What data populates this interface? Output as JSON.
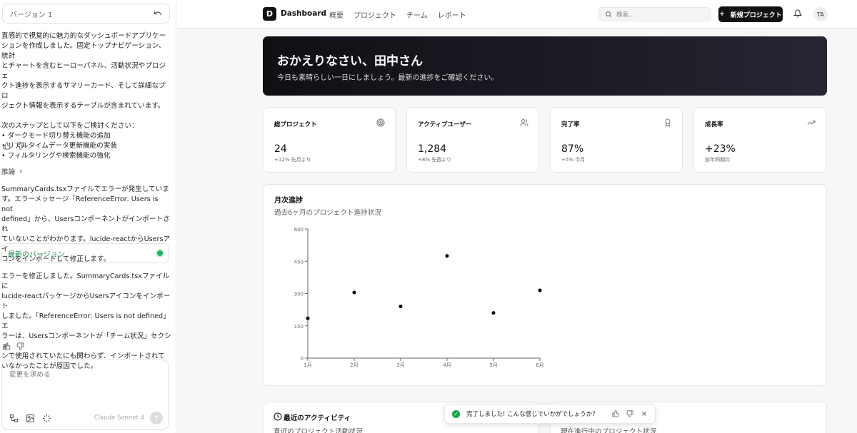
{
  "left_panel": {
    "version_label": "バージョン 1",
    "message1": "直感的で視覚的に魅力的なダッシュボードアプリケー\nションを作成しました。固定トップナビゲーション、統計\nとチャートを含むヒーローパネル、活動状況やプロジェ\nクト進捗を表示するサマリーカード、そして詳細なプロ\nジェクト情報を表示するテーブルが含まれています。\n\n次のステップとして以下をご検討ください：\n• ダークモード切り替え機能の追加\n• リアルタイムデータ更新機能の実装\n• フィルタリングや検索機能の強化",
    "reasoning_label": "推論",
    "message2": "SummaryCards.tsxファイルでエラーが発生していま\nす。エラーメッセージ「ReferenceError: Users is not\ndefined」から、Usersコンポーネントがインポートされ\nていないことがわかります。lucide-reactからUsersアイ\nコンをインポートして修正します。",
    "latest_version_label": "最新のバージョン",
    "message3": "エラーを修正しました。SummaryCards.tsxファイルに\nlucide-reactパッケージからUsersアイコンをインポート\nしました。「ReferenceError: Users is not defined」エ\nラーは、Usersコンポーネントが「チーム状況」セクショ\nンで使用されていたにも関わらず、インポートされて\nいなかったことが原因でした。",
    "input_placeholder": "変更を求める",
    "model_name": "Claude Sonnet 4"
  },
  "topbar": {
    "logo_letter": "D",
    "brand": "Dashboard",
    "nav": [
      "概要",
      "プロジェクト",
      "チーム",
      "レポート"
    ],
    "search_placeholder": "検索...",
    "new_project_label": "新規プロジェクト",
    "avatar_initials": "TA"
  },
  "hero": {
    "title": "おかえりなさい、田中さん",
    "subtitle": "今日も素晴らしい一日にしましょう。最新の進捗をご確認ください。"
  },
  "cards": [
    {
      "title": "総プロジェクト",
      "value": "24",
      "sub": "+12% 先月より",
      "icon": "target-icon"
    },
    {
      "title": "アクティブユーザー",
      "value": "1,284",
      "sub": "+8% 先週より",
      "icon": "users-icon"
    },
    {
      "title": "完了率",
      "value": "87%",
      "sub": "+5% 今月",
      "icon": "award-icon"
    },
    {
      "title": "成長率",
      "value": "+23%",
      "sub": "前年同期比",
      "icon": "trending-up-icon"
    }
  ],
  "chart_section": {
    "title": "月次進捗",
    "subtitle": "過去6ヶ月のプロジェクト進捗状況"
  },
  "chart_data": {
    "type": "scatter",
    "categories": [
      "1月",
      "2月",
      "3月",
      "4月",
      "5月",
      "6月"
    ],
    "values": [
      185,
      305,
      240,
      475,
      210,
      315
    ],
    "ylim": [
      0,
      600
    ],
    "yticks": [
      0,
      150,
      300,
      450,
      600
    ],
    "grid": false
  },
  "bottom_cards": [
    {
      "title": "最近のアクティビティ",
      "sub": "直近のプロジェクト活動状況"
    },
    {
      "title": "",
      "sub": "現在進行中のプロジェクト状況"
    }
  ],
  "toast": {
    "text": "完了しました! こんな感じでいかがでしょうか?"
  },
  "colors": {
    "accent": "#111111",
    "success": "#16a34a",
    "latest_text": "#1a8a4c"
  }
}
